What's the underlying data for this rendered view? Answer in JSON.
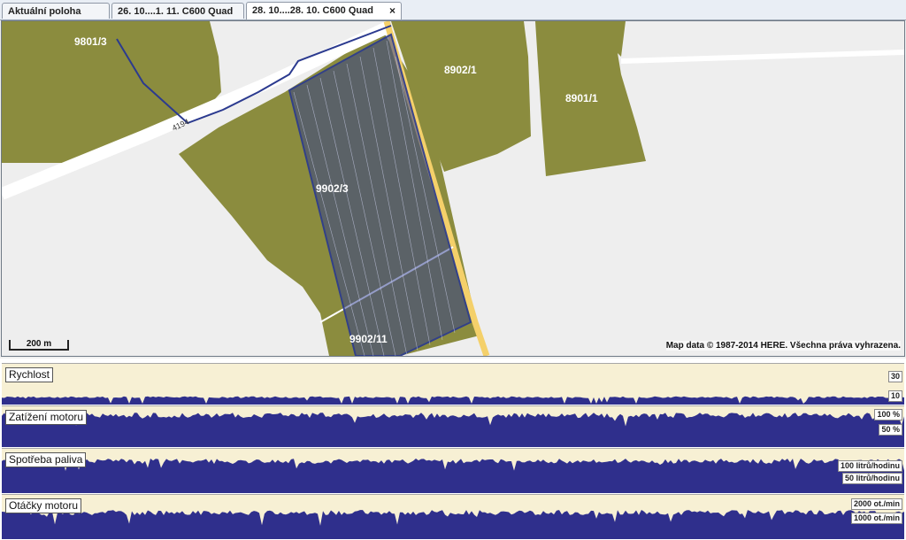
{
  "tabs": [
    {
      "label": "Aktuální poloha"
    },
    {
      "label": "26. 10....1. 11. C600 Quad"
    },
    {
      "label": "28. 10....28. 10. C600 Quad"
    }
  ],
  "close_glyph": "×",
  "map": {
    "parcels": [
      "9801/3",
      "8902/1",
      "8901/1",
      "9902/3",
      "9902/11"
    ],
    "road_number": "4194",
    "scale_label": "200 m",
    "copyright": "Map data © 1987-2014 HERE. Všechna práva vyhrazena.",
    "colors": {
      "field": "#8b8c3e",
      "track": "#2b3a8f",
      "road": "#f4d06a",
      "background": "#eeeeee"
    }
  },
  "charts": [
    {
      "title": "Rychlost",
      "upper_label": "30",
      "lower_label": "10",
      "level": 0.18
    },
    {
      "title": "Zatížení motoru",
      "upper_label": "100 %",
      "lower_label": "50 %",
      "level": 0.78
    },
    {
      "title": "Spotřeba paliva",
      "upper_label": "100 litrů/hodinu",
      "lower_label": "50 litrů/hodinu",
      "level": 0.72
    },
    {
      "title": "Otáčky motoru",
      "upper_label": "2000 ot./min",
      "lower_label": "1000 ot./min",
      "level": 0.6
    }
  ],
  "chart_colors": {
    "fill": "#2f2f8c",
    "background": "#f7f0d4"
  }
}
